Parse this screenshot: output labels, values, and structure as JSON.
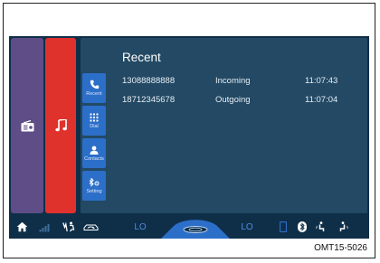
{
  "panel": {
    "title": "Recent"
  },
  "side_buttons": [
    {
      "label": "Recent",
      "icon": "phone-icon"
    },
    {
      "label": "Dial",
      "icon": "keypad-icon"
    },
    {
      "label": "Contacts",
      "icon": "person-icon"
    },
    {
      "label": "Setting",
      "icon": "bluetooth-settings-icon"
    }
  ],
  "calls": [
    {
      "number": "13088888888",
      "direction": "Incoming",
      "time": "11:07:43"
    },
    {
      "number": "18712345678",
      "direction": "Outgoing",
      "time": "11:07:04"
    }
  ],
  "bottom_bar": {
    "left_temp": "LO",
    "right_temp": "LO"
  },
  "caption": "OMT15-5026",
  "colors": {
    "screen_bg": "#0f2f49",
    "panel_bg": "#234964",
    "radio_tile": "#5e4d86",
    "music_tile": "#e0322d",
    "side_button": "#2c6fc9",
    "temp_text": "#4b8be0"
  }
}
